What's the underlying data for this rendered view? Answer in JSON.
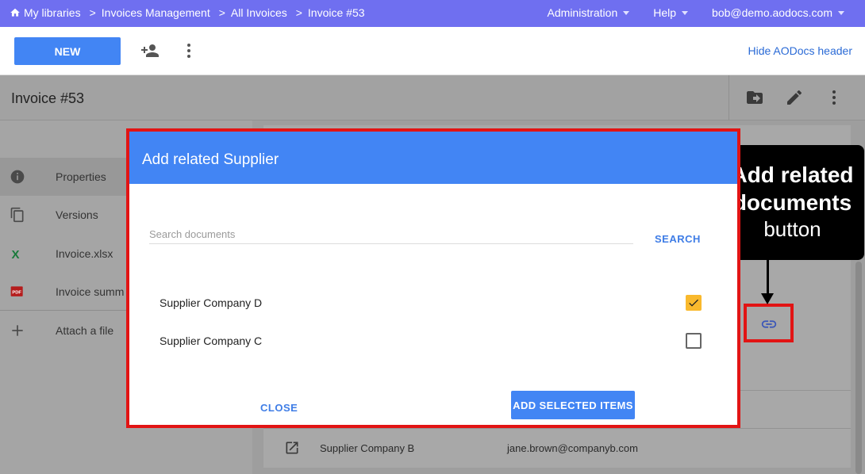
{
  "breadcrumb": {
    "items": [
      "My libraries",
      "Invoices Management",
      "All Invoices",
      "Invoice #53"
    ],
    "separator": ">"
  },
  "topmenu": {
    "administration": "Administration",
    "help": "Help",
    "user": "bob@demo.aodocs.com"
  },
  "toolbar": {
    "new_label": "NEW",
    "hide_header_label": "Hide AODocs header"
  },
  "document": {
    "title": "Invoice #53"
  },
  "sidebar": {
    "items": [
      {
        "label": "Properties",
        "icon": "info-icon"
      },
      {
        "label": "Versions",
        "icon": "copy-icon"
      },
      {
        "label": "Invoice.xlsx",
        "icon": "excel-icon"
      },
      {
        "label": "Invoice summ",
        "icon": "pdf-icon"
      },
      {
        "label": "Attach a file",
        "icon": "plus-icon"
      }
    ]
  },
  "content": {
    "bottom_row": {
      "name": "Supplier Company B",
      "email": "jane.brown@companyb.com"
    }
  },
  "modal": {
    "title": "Add related Supplier",
    "search_placeholder": "Search documents",
    "search_label": "SEARCH",
    "results": [
      {
        "label": "Supplier Company D",
        "checked": true
      },
      {
        "label": "Supplier Company C",
        "checked": false
      }
    ],
    "close_label": "CLOSE",
    "add_label": "ADD SELECTED ITEMS"
  },
  "annotation": {
    "line1": "Add related",
    "line2": "documents",
    "line3": "button"
  },
  "colors": {
    "nav": "#6f6ff0",
    "primary": "#4285f4",
    "highlight": "#e21414",
    "checkbox": "#f9b92d"
  }
}
